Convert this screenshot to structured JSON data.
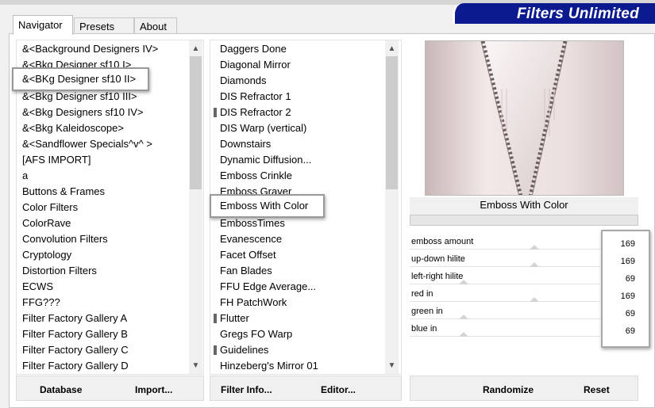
{
  "brand": {
    "title": "Filters Unlimited"
  },
  "tabs": [
    {
      "label": "Navigator",
      "active": true
    },
    {
      "label": "Presets",
      "active": false
    },
    {
      "label": "About",
      "active": false
    }
  ],
  "categories": {
    "items": [
      "&<Background Designers IV>",
      "&<Bkg Designer sf10 I>",
      "&<BKg Designer sf10 II>",
      "&<Bkg Designer sf10 III>",
      "&<Bkg Designers sf10 IV>",
      "&<Bkg Kaleidoscope>",
      "&<Sandflower Specials^v^ >",
      "[AFS IMPORT]",
      "a",
      "Buttons & Frames",
      "Color Filters",
      "ColorRave",
      "Convolution Filters",
      "Cryptology",
      "Distortion Filters",
      "ECWS",
      "FFG???",
      "Filter Factory Gallery A",
      "Filter Factory Gallery B",
      "Filter Factory Gallery C",
      "Filter Factory Gallery D"
    ],
    "selected": "&<BKg Designer sf10 II>"
  },
  "filters": {
    "items": [
      "Daggers Done",
      "Diagonal Mirror",
      "Diamonds",
      "DIS Refractor 1",
      "DIS Refractor 2",
      "DIS Warp (vertical)",
      "Downstairs",
      "Dynamic Diffusion...",
      "Emboss Crinkle",
      "Emboss Graver",
      "Emboss With Color",
      "EmbossTimes",
      "Evanescence",
      "Facet Offset",
      "Fan Blades",
      "FFU Edge Average...",
      "FH PatchWork",
      "Flutter",
      "Gregs FO Warp",
      "Guidelines",
      "Hinzeberg's Mirror 01"
    ],
    "grip_items": [
      "DIS Refractor 2",
      "Flutter",
      "Guidelines"
    ],
    "selected": "Emboss With Color"
  },
  "preview": {
    "filter_name": "Emboss With Color"
  },
  "parameters": [
    {
      "label": "emboss amount",
      "value": "169",
      "level": 169
    },
    {
      "label": "up-down hilite",
      "value": "169",
      "level": 169
    },
    {
      "label": "left-right hilite",
      "value": "69",
      "level": 69
    },
    {
      "label": "red in",
      "value": "169",
      "level": 169
    },
    {
      "label": "green in",
      "value": "69",
      "level": 69
    },
    {
      "label": "blue in",
      "value": "69",
      "level": 69
    }
  ],
  "buttons": {
    "database": "Database",
    "import": "Import...",
    "filter_info": "Filter Info...",
    "editor": "Editor...",
    "randomize": "Randomize",
    "reset": "Reset"
  },
  "colors": {
    "brand_bg": "#0b1a8f",
    "preview_tone": "#e9dcdc"
  }
}
